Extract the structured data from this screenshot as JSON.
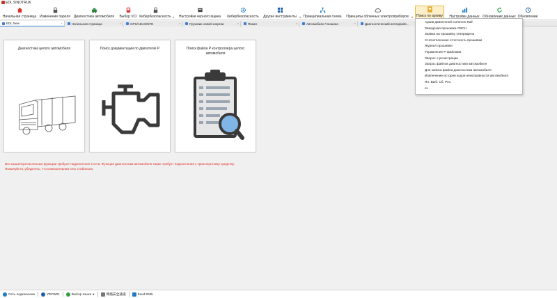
{
  "window": {
    "title": "EDL SINOTRUK"
  },
  "toolbar": {
    "buttons": [
      {
        "label": "Начальная страница",
        "icon": "home-icon",
        "color": "#d9342b"
      },
      {
        "label": "Изменение пароля",
        "icon": "lock-icon",
        "color": "#555555"
      },
      {
        "label": "Диагностика автомобиля",
        "icon": "car-diagnostics-icon",
        "color": "#2b8a3e"
      },
      {
        "label": "Выбор VCI",
        "icon": "vci-device-icon",
        "color": "#d9342b"
      },
      {
        "label": "Кибербезопасность",
        "icon": "lock-icon",
        "color": "#555555"
      },
      {
        "label": "Настройки черного ящика",
        "icon": "black-box-icon",
        "color": "#444444"
      },
      {
        "label": "Кибербезопасность",
        "icon": "gear-icon",
        "color": "#1f7ac2"
      },
      {
        "label": "Другие инструменты",
        "icon": "grid-icon",
        "color": "#1f5fa8"
      },
      {
        "label": "Принципиальная схема",
        "icon": "schematic-icon",
        "color": "#1f7ac2"
      },
      {
        "label": "Принципы облачных электроприборов",
        "icon": "cloud-icon",
        "color": "#555555"
      },
      {
        "label": "Поиск по архиву",
        "icon": "archive-search-icon",
        "color": "#e08a00"
      },
      {
        "label": "Настройки данных",
        "icon": "data-settings-icon",
        "color": "#1f7ac2"
      },
      {
        "label": "Обновление данных",
        "icon": "refresh-icon",
        "color": "#2ea043"
      },
      {
        "label": "Обновление",
        "icon": "update-icon",
        "color": "#1f5fa8"
      }
    ],
    "separator_glyph": "▾"
  },
  "tabs": [
    {
      "label": "EDL New"
    },
    {
      "label": "Начальная страница"
    },
    {
      "label": "GPS/ADAS/NTE"
    },
    {
      "label": "Грузовик новой энергии"
    },
    {
      "label": "Пикап"
    },
    {
      "label": "Автомобили Чэншина"
    },
    {
      "label": "Диагностический интерфейс..."
    }
  ],
  "tab_close_glyph": "×",
  "cards": [
    {
      "title": "Диагностика целого автомобиля",
      "icon": "truck-icon"
    },
    {
      "title": "Поиск документации по двигателю P",
      "icon": "engine-icon"
    },
    {
      "title": "Поиск файла P контроллера целого автомобиля",
      "icon": "clipboard-search-icon"
    }
  ],
  "notice": {
    "line1": "Все вышеперечисленные функции требуют подключения к сети. Функция диагностики автомобиля также требует подключения к транспортному средству.",
    "line2": "Пожалуйста, убедитесь, что компьютерная сеть стабильна.",
    "color": "#e0281e"
  },
  "archive_menu": {
    "items": [
      "Архив двигателей Common Rail",
      "Заводская прошивка CBCU",
      "Заявка на прошивку утверждена",
      "Статистическая отчетность прошивки",
      "Журнал прошивки",
      "Управление P-файлами",
      "Запрос о регистрации",
      "Запрос файлов диагностики автомобиля",
      "Для записи файла диагностики автомобиля",
      "Извлечение истории кодов неисправности автомобиля",
      "Ял. Выб. Сб. Рез.",
      "cs"
    ]
  },
  "statusbar": {
    "network": "Сеть подключена",
    "vci": "YEFW01",
    "language": "Выбор языка",
    "language_suffix": "▾",
    "security": "网络安全通道",
    "baud": "baud:250k"
  }
}
